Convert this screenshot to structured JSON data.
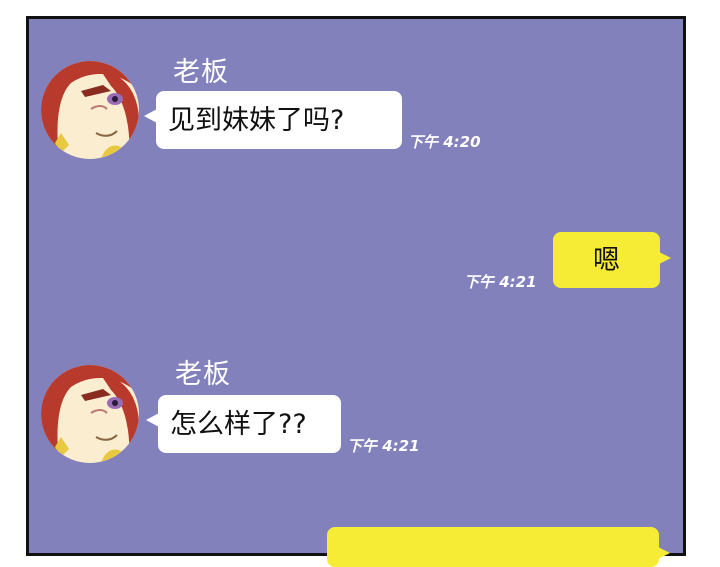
{
  "messages": [
    {
      "side": "left",
      "sender": "老板",
      "text": "见到妹妹了吗?",
      "time": "下午 4:20"
    },
    {
      "side": "right",
      "text": "嗯",
      "time": "下午 4:21"
    },
    {
      "side": "left",
      "sender": "老板",
      "text": "怎么样了??",
      "time": "下午 4:21"
    },
    {
      "side": "right",
      "text": "",
      "time": ""
    }
  ],
  "colors": {
    "background": "#8281bb",
    "incoming_bubble": "#ffffff",
    "outgoing_bubble": "#f7ec35"
  },
  "icons": {
    "avatar": "boss-avatar-icon"
  }
}
